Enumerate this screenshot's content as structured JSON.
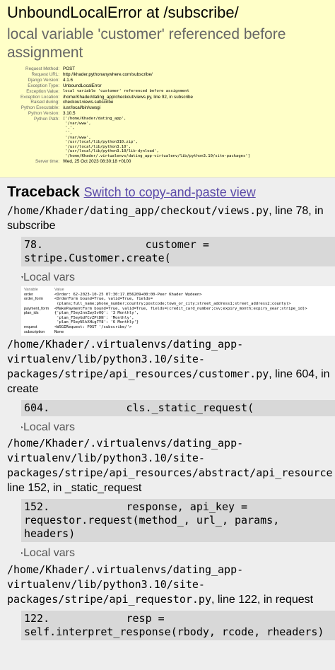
{
  "summary": {
    "title": "UnboundLocalError at /subscribe/",
    "message": "local variable 'customer' referenced before assignment",
    "meta": [
      {
        "k": "Request Method:",
        "v": "POST"
      },
      {
        "k": "Request URL:",
        "v": "http://khader.pythonanywhere.com/subscribe/"
      },
      {
        "k": "Django Version:",
        "v": "4.1.6"
      },
      {
        "k": "Exception Type:",
        "v": "UnboundLocalError"
      },
      {
        "k": "Exception Value:",
        "v": "local variable 'customer' referenced before assignment"
      },
      {
        "k": "Exception Location:",
        "v": "/home/Khader/dating_app/checkout/views.py, line 92, in subscribe"
      },
      {
        "k": "Raised during:",
        "v": "checkout.views.subscribe"
      },
      {
        "k": "Python Executable:",
        "v": "/usr/local/bin/uwsgi"
      },
      {
        "k": "Python Version:",
        "v": "3.10.5"
      },
      {
        "k": "Python Path:",
        "v": "['/home/Khader/dating_app',\n '/var/www',\n '.',\n '',\n '/var/www',\n '/usr/local/lib/python310.zip',\n '/usr/local/lib/python3.10',\n '/usr/local/lib/python3.10/lib-dynload',\n '/home/Khader/.virtualenvs/dating_app-virtualenv/lib/python3.10/site-packages']"
      },
      {
        "k": "Server time:",
        "v": "Wed, 25 Oct 2023 08:30:18 +0100"
      }
    ]
  },
  "traceback": {
    "title": "Traceback",
    "switch_link": "Switch to copy-and-paste view",
    "local_vars_label": "Local vars",
    "frames": [
      {
        "file": "/home/Khader/dating_app/checkout/views.py",
        "suffix": ", line 78, in subscribe",
        "code": "78.                customer = stripe.Customer.create(",
        "vars_header": {
          "variable": "Variable",
          "value": "Value"
        },
        "vars": [
          {
            "name": "order",
            "value": "<Order: 62-2023-10-25 07:30:17.856209+00:00-Peer Khader Wydeen>"
          },
          {
            "name": "order_form",
            "value": "<OrderForm bound=True, valid=True, fields=\n (plans;full_name;phone_number;country;postcode;town_or_city;street_address1;street_address2;county)>"
          },
          {
            "name": "payment_form",
            "value": "<MakePaymentForm bound=True, valid=True, fields=(credit_card_number;cvv;expiry_month;expiry_year;stripe_id)>"
          },
          {
            "name": "plan_ids",
            "value": "{'plan_F5ey2nnZwy5v0Q': '3 Monthly',\n 'plan_F5eyGdYCvZPtDN': 'Monthly',\n 'plan_F5eyNlkXHig7Y8': '6 Monthly'}"
          },
          {
            "name": "request",
            "value": "<WSGIRequest: POST '/subscribe/'>"
          },
          {
            "name": "subscription",
            "value": "None"
          }
        ]
      },
      {
        "file": "/home/Khader/.virtualenvs/dating_app-virtualenv/lib/python3.10/site-packages/stripe/api_resources/customer.py",
        "suffix": ", line 604, in create",
        "code": "604.            cls._static_request("
      },
      {
        "file": "/home/Khader/.virtualenvs/dating_app-virtualenv/lib/python3.10/site-packages/stripe/api_resources/abstract/api_resource.py",
        "suffix": ", line 152, in _static_request",
        "code": "152.            response, api_key = requestor.request(method_, url_, params, headers)"
      },
      {
        "file": "/home/Khader/.virtualenvs/dating_app-virtualenv/lib/python3.10/site-packages/stripe/api_requestor.py",
        "suffix": ", line 122, in request",
        "code": "122.            resp = self.interpret_response(rbody, rcode, rheaders)"
      }
    ]
  }
}
